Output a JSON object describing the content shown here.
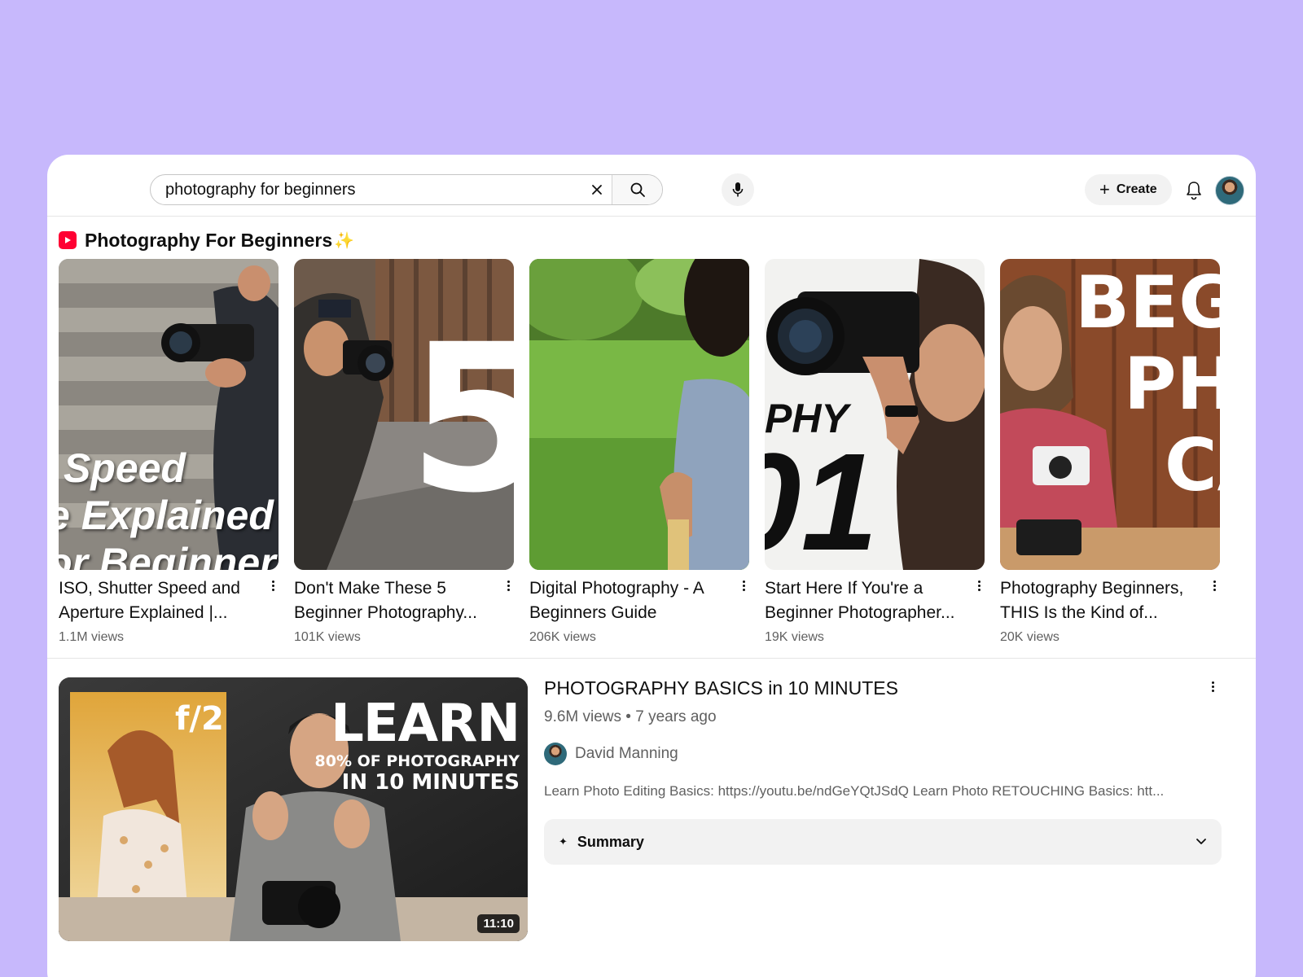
{
  "search": {
    "value": "photography for beginners",
    "clear_icon": "close-icon",
    "search_icon": "search-icon",
    "mic_icon": "mic-icon"
  },
  "header": {
    "create_label": "Create",
    "notifications_icon": "bell-icon"
  },
  "shelf": {
    "title": "Photography For Beginners",
    "sparkle": "✨",
    "items": [
      {
        "title": "ISO, Shutter Speed and Aperture Explained |...",
        "views": "1.1M views",
        "overlay_lines": [
          "Speed",
          "e Explained",
          "or Beginners"
        ]
      },
      {
        "title": "Don't Make These 5 Beginner Photography...",
        "views": "101K views",
        "overlay_lines": [
          "5"
        ]
      },
      {
        "title": "Digital Photography - A Beginners Guide",
        "views": "206K views",
        "overlay_lines": []
      },
      {
        "title": "Start Here If You're a Beginner Photographer...",
        "views": "19K views",
        "overlay_lines": [
          "PHY",
          "01"
        ]
      },
      {
        "title": "Photography Beginners, THIS Is the Kind of...",
        "views": "20K views",
        "overlay_lines": [
          "BEGI",
          "PHO",
          "CA"
        ]
      }
    ]
  },
  "video": {
    "title": "PHOTOGRAPHY BASICS in 10 MINUTES",
    "meta": "9.6M views • 7 years ago",
    "channel": "David Manning",
    "description": "Learn Photo Editing Basics: https://youtu.be/ndGeYQtJSdQ Learn Photo RETOUCHING Basics: htt...",
    "duration": "11:10",
    "thumb_text": {
      "fstop": "f/2",
      "big": "LEARN",
      "line1": "80% OF PHOTOGRAPHY",
      "line2": "IN 10 MINUTES"
    },
    "summary_label": "Summary"
  },
  "colors": {
    "background": "#c7b8fc",
    "shorts_red": "#ff0033"
  }
}
